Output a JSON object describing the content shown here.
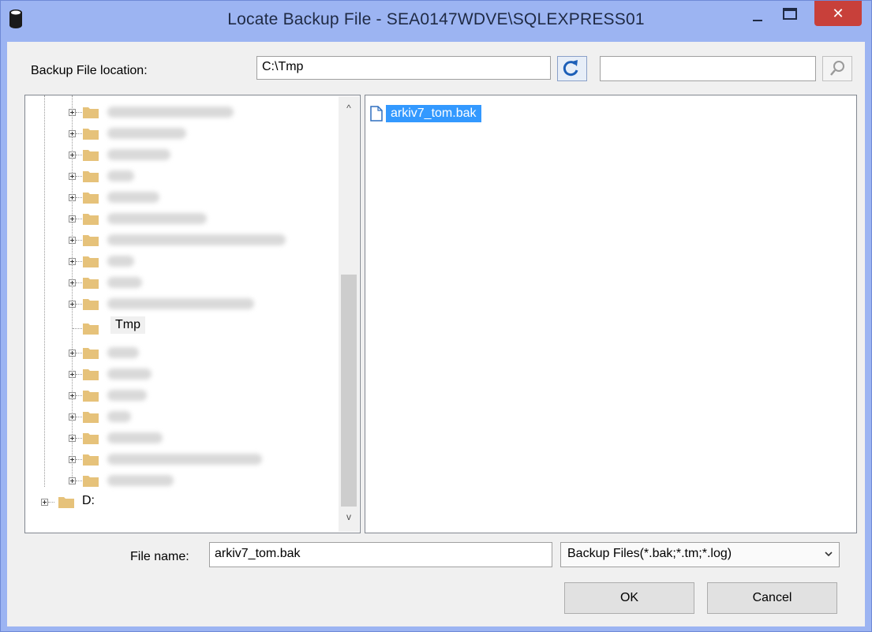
{
  "window": {
    "title": "Locate Backup File - SEA0147WDVE\\SQLEXPRESS01",
    "close_glyph": "✕"
  },
  "location": {
    "label": "Backup File location:",
    "value": "C:\\Tmp",
    "filter_value": ""
  },
  "tree": {
    "selected_folder": "Tmp",
    "drive_label": "D:",
    "scroll_up_glyph": "^",
    "scroll_down_glyph": "v"
  },
  "files": [
    {
      "name": "arkiv7_tom.bak",
      "selected": true
    }
  ],
  "filename": {
    "label": "File name:",
    "value": "arkiv7_tom.bak"
  },
  "filetype": {
    "selected": "Backup Files(*.bak;*.tm;*.log)"
  },
  "buttons": {
    "ok": "OK",
    "cancel": "Cancel"
  },
  "colors": {
    "title_bar": "#9cb4f2",
    "close_button": "#c8403a",
    "selection": "#3399ff",
    "folder": "#e6c27a"
  },
  "icons": [
    "database-icon",
    "minimize-icon",
    "maximize-icon",
    "close-icon",
    "refresh-icon",
    "search-icon",
    "folder-icon",
    "expand-icon",
    "file-icon",
    "chevron-down-icon"
  ]
}
